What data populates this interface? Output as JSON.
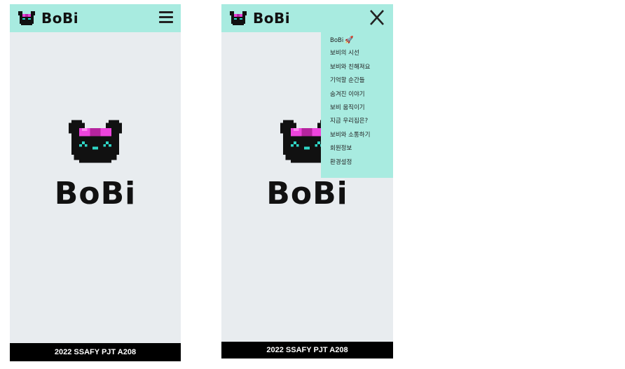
{
  "colors": {
    "accent": "#a8ebe0",
    "background": "#e8ecef",
    "footer": "#000000"
  },
  "brand": {
    "name": "BoBi",
    "logo_icon": "bear-icon"
  },
  "hero": {
    "title": "BoBi"
  },
  "footer": {
    "text": "2022 SSAFY PJT A208"
  },
  "menu": {
    "open_icon": "hamburger-menu-icon",
    "close_icon": "close-icon",
    "items": [
      {
        "label": "BoBi",
        "icon": "rocket-icon",
        "icon_glyph": "🚀"
      },
      {
        "label": "보비의 시선"
      },
      {
        "label": "보비와 친해져요"
      },
      {
        "label": "기억할 순간들"
      },
      {
        "label": "숨겨진 이야기"
      },
      {
        "label": "보비 움직이기"
      },
      {
        "label": "지금 우리집은?"
      },
      {
        "label": "보비와 소통하기"
      },
      {
        "label": "회원정보"
      },
      {
        "label": "환경설정"
      }
    ]
  }
}
